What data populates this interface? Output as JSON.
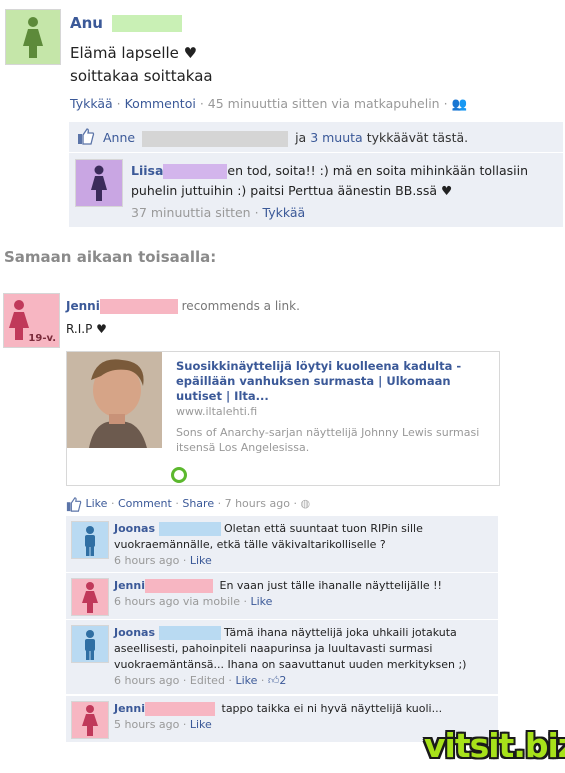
{
  "post1": {
    "author": "Anu",
    "line1": "Elämä lapselle ♥",
    "line2": "soittakaa soittakaa",
    "actions": {
      "like": "Tykkää",
      "comment": "Kommentoi",
      "time": "45 minuuttia sitten via matkapuhelin"
    },
    "likes": {
      "name": "Anne",
      "mid": "ja",
      "others": "3 muuta",
      "tail": "tykkäävät tästä."
    },
    "comment": {
      "author": "Liisa",
      "text1": "en tod, soita!! :) mä en soita mihinkään tollasiin",
      "text2": "puhelin juttuihin :) paitsi Perttua äänestin BB.ssä ♥",
      "time": "37 minuuttia sitten",
      "like": "Tykkää"
    }
  },
  "heading": "Samaan aikaan toisaalla:",
  "post2": {
    "author": "Jenni",
    "badge": "19-v.",
    "verb": "recommends a link.",
    "text": "R.I.P ♥",
    "share": {
      "title": "Suosikkinäyttelijä löytyi kuolleena kadulta - epäillään vanhuksen surmasta | Ulkomaan uutiset | Ilta...",
      "url": "www.iltalehti.fi",
      "desc": "Sons of Anarchy-sarjan näyttelijä Johnny Lewis surmasi itsensä Los Angelesissa."
    },
    "actions": {
      "like": "Like",
      "comment": "Comment",
      "share": "Share",
      "time": "7 hours ago"
    },
    "comments": [
      {
        "author": "Joonas",
        "text": "Oletan että suuntaat tuon RIPin sille vuokraemännälle, etkä tälle väkivaltarikolliselle ?",
        "time": "6 hours ago",
        "like": "Like"
      },
      {
        "author": "Jenni",
        "text": "En vaan just tälle ihanalle näyttelijälle !!",
        "time": "6 hours ago via mobile",
        "like": "Like"
      },
      {
        "author": "Joonas",
        "text": "Tämä ihana näyttelijä joka uhkaili jotakuta aseellisesti, pahoinpiteli naapurinsa ja luultavasti surmasi vuokraemäntänsä... Ihana on saavuttanut uuden merkityksen ;)",
        "time": "6 hours ago",
        "edited": "Edited",
        "like": "Like",
        "like_count": "2"
      },
      {
        "author": "Jenni",
        "text": "tappo taikka ei ni hyvä näyttelijä kuoli...",
        "time": "5 hours ago",
        "like": "Like"
      }
    ]
  },
  "watermark": "vitsit.biz",
  "colors": {
    "link": "#3b5998",
    "female_green": "#c5e6a9",
    "female_purple": "#c9a6e3",
    "female_pink": "#f7b6c2",
    "male_blue": "#b9daf2",
    "comment_bg": "#eceff5"
  }
}
